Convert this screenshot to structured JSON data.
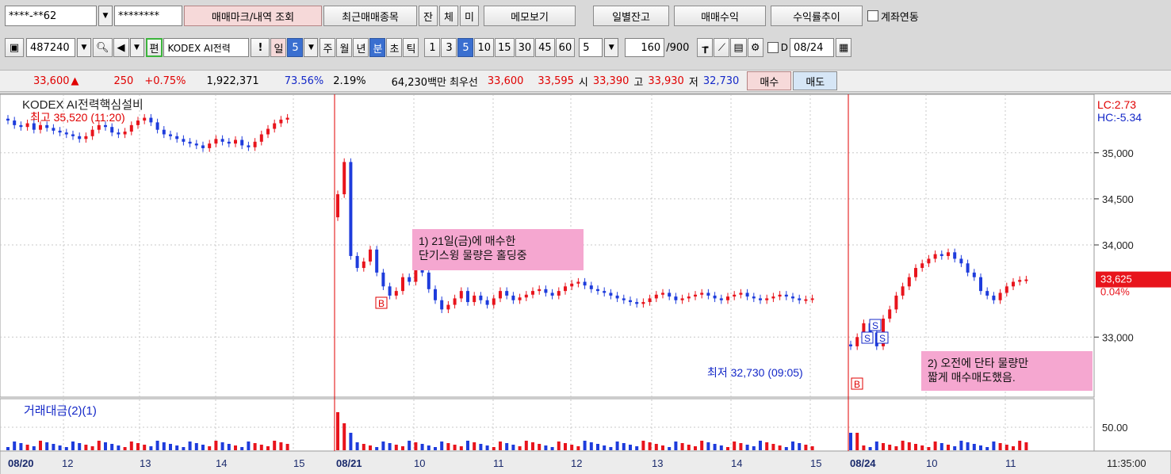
{
  "toolbar1": {
    "account": "****-**62",
    "password": "********",
    "mark_btn": "매매마크/내역 조회",
    "recent_btn": "최근매매종목",
    "tabs": [
      "잔",
      "체",
      "미"
    ],
    "memo_btn": "메모보기",
    "daily_balance_btn": "일별잔고",
    "trade_profit_btn": "매매수익",
    "profit_trend_btn": "수익률추이",
    "link_label": "계좌연동"
  },
  "toolbar2": {
    "code": "487240",
    "edit_label": "편",
    "stock_name": "KODEX AI전력",
    "excl": "!",
    "period_day": "일",
    "period_n": "5",
    "periods": [
      "주",
      "월",
      "년"
    ],
    "minute": "분",
    "sec": "초",
    "tick": "틱",
    "intervals": [
      "1",
      "3",
      "5",
      "10",
      "15",
      "30",
      "45",
      "60"
    ],
    "interval_selected": "5",
    "count_n": "5",
    "count_value": "160",
    "count_max": "/900",
    "d_label": "D",
    "date": "08/24"
  },
  "quote": {
    "price": "33,600",
    "change": "250",
    "pct": "+0.75%",
    "volume": "1,922,371",
    "ratio1": "73.56%",
    "ratio2": "2.19%",
    "amount": "64,230백만",
    "best_label": "최우선",
    "best_ask": "33,600",
    "best_bid": "33,595",
    "open_label": "시",
    "open": "33,390",
    "high_label": "고",
    "high": "33,930",
    "low_label": "저",
    "low": "32,730",
    "buy_btn": "매수",
    "sell_btn": "매도"
  },
  "chart": {
    "title": "KODEX AI전력핵심설비",
    "high_note": "최고 35,520 (11:20)",
    "low_note": "최저 32,730 (09:05)",
    "lc_label": "LC:2.73",
    "hc_label": "HC:-5.34",
    "current_price": "33,625",
    "current_pct": "0.04%",
    "price_ticks": [
      "35,000",
      "34,500",
      "34,000",
      "33,000"
    ],
    "volume_title": "거래대금(2)(1)",
    "volume_tick": "50.00",
    "annotation1_line1": "1) 21일(금)에 매수한",
    "annotation1_line2": "단기스윙 물량은 홀딩중",
    "annotation2_line1": "2) 오전에 단타 물량만",
    "annotation2_line2": "짧게 매수매도했음.",
    "x_labels": [
      "08/20",
      "12",
      "13",
      "14",
      "15",
      "08/21",
      "10",
      "11",
      "12",
      "13",
      "14",
      "15",
      "08/24",
      "10",
      "11"
    ],
    "time_label": "11:35:00",
    "mark_buy": "B",
    "mark_sell": "S",
    "colors": {
      "up": "#e8141c",
      "down": "#1e3cdc",
      "bg": "#ffffff",
      "grid": "#c8c8c8"
    }
  },
  "chart_data": {
    "type": "candlestick",
    "y_range": [
      32400,
      35600
    ],
    "segments": [
      {
        "day": "08/20",
        "closes": [
          35350,
          35300,
          35280,
          35320,
          35250,
          35300,
          35270,
          35240,
          35220,
          35200,
          35180,
          35150,
          35180,
          35250,
          35300,
          35280,
          35220,
          35200,
          35230,
          35300,
          35350,
          35380,
          35330,
          35250,
          35200,
          35180,
          35150,
          35120,
          35100,
          35080,
          35050,
          35100,
          35150,
          35120,
          35100,
          35140,
          35080,
          35060,
          35120,
          35200,
          35260,
          35320,
          35360,
          35380
        ]
      },
      {
        "day": "08/21",
        "closes": [
          34550,
          34900,
          33880,
          33750,
          33820,
          33950,
          33700,
          33550,
          33450,
          33500,
          33650,
          33600,
          33780,
          33700,
          33520,
          33400,
          33300,
          33350,
          33420,
          33500,
          33380,
          33450,
          33400,
          33350,
          33420,
          33500,
          33450,
          33400,
          33430,
          33460,
          33500,
          33520,
          33480,
          33450,
          33500,
          33550,
          33580,
          33600,
          33560,
          33520,
          33500,
          33480,
          33450,
          33420,
          33400,
          33380,
          33360,
          33380,
          33420,
          33460,
          33480,
          33440,
          33400,
          33420,
          33440,
          33460,
          33480,
          33450,
          33420,
          33400,
          33440,
          33460,
          33480,
          33440,
          33420,
          33400,
          33420,
          33440,
          33460,
          33440,
          33420,
          33400,
          33410,
          33420
        ]
      },
      {
        "day": "08/24",
        "closes": [
          32900,
          33000,
          33150,
          33050,
          32900,
          33200,
          33300,
          33450,
          33550,
          33650,
          33750,
          33800,
          33850,
          33900,
          33880,
          33920,
          33850,
          33800,
          33700,
          33650,
          33500,
          33450,
          33400,
          33480,
          33550,
          33600,
          33620,
          33625
        ]
      }
    ]
  }
}
